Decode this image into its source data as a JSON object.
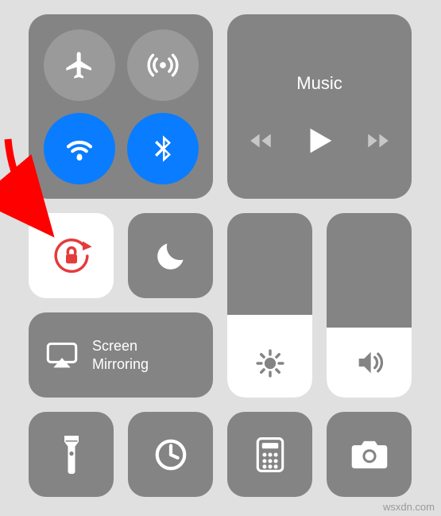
{
  "music": {
    "title": "Music"
  },
  "screen_mirroring": {
    "label_line1": "Screen",
    "label_line2": "Mirroring"
  },
  "sliders": {
    "brightness_percent": 45,
    "volume_percent": 38
  },
  "colors": {
    "accent_blue": "#0a7cff",
    "panel_grey": "#848484",
    "lock_red": "#e43b3b"
  },
  "watermark": "wsxdn.com",
  "icons": {
    "airplane": "airplane-icon",
    "cellular": "cellular-icon",
    "wifi": "wifi-icon",
    "bluetooth": "bluetooth-icon",
    "previous": "previous-track-icon",
    "play": "play-icon",
    "next": "next-track-icon",
    "rotation_lock": "rotation-lock-icon",
    "do_not_disturb": "moon-icon",
    "airplay": "airplay-icon",
    "brightness": "brightness-icon",
    "volume": "speaker-icon",
    "flashlight": "flashlight-icon",
    "timer": "timer-icon",
    "calculator": "calculator-icon",
    "camera": "camera-icon"
  }
}
